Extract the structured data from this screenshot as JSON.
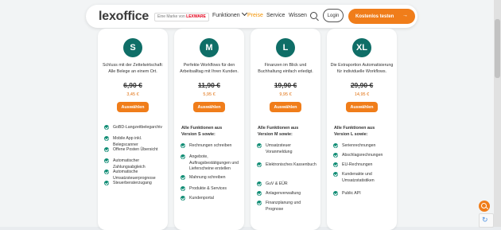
{
  "header": {
    "logo_main": "lexoffice",
    "badge_prefix": "Eine Marke von",
    "badge_brand": "LEXWARE",
    "nav": [
      "Funktionen",
      "Preise",
      "Service",
      "Wissen"
    ],
    "login_label": "Login",
    "cta_label": "Kostenlos testen",
    "cta_arrow": "→"
  },
  "colors": {
    "accent": "#f07d1a",
    "tier": "#0f6e67",
    "check": "#0f8c74"
  },
  "plans": [
    {
      "tier": "S",
      "description": "Schluss mit der Zettelwirtschaft: Alle Belege an einem Ort.",
      "old_price": "6,90 €",
      "new_price": "3,45 €",
      "button": "Auswählen",
      "features_heading": "",
      "features": [
        "GoBD-Langzeitbelegarchiv",
        "Mobile App inkl. Belegscanner",
        "Offene Posten Übersicht",
        "Automatischer Zahlungsabgleich",
        "Automatische Umsatzsteuerprognose",
        "Steuerberaterzugang"
      ]
    },
    {
      "tier": "M",
      "description": "Perfekte Workflows für den Arbeitsalltag mit Ihren Kunden.",
      "old_price": "11,90 €",
      "new_price": "5,95 €",
      "button": "Auswählen",
      "features_heading": "Alle Funktionen aus Version S sowie:",
      "features": [
        "Rechnungen schreiben",
        "Angebote, Auftragsbestätigungen und Lieferscheine erstellen",
        "Mahnung schreiben",
        "Produkte & Services",
        "Kundenportal"
      ]
    },
    {
      "tier": "L",
      "description": "Finanzen im Blick und Buchhaltung einfach erledigt.",
      "old_price": "19,90 €",
      "new_price": "9,95 €",
      "button": "Auswählen",
      "features_heading": "Alle Funktionen aus Version M sowie:",
      "features": [
        "Umsatzsteuer Voranmeldung",
        "Elektronisches Kassenbuch",
        "GuV & EÜR",
        "Anlagenverwaltung",
        "Finanzplanung und Prognose"
      ]
    },
    {
      "tier": "XL",
      "description": "Die Extraportion Automatisierung für individuelle Workflows.",
      "old_price": "29,90 €",
      "new_price": "14,95 €",
      "button": "Auswählen",
      "features_heading": "Alle Funktionen aus Version L sowie:",
      "features": [
        "Serienrechnungen",
        "Abschlagsrechnungen",
        "EU-Rechnungen",
        "Kundenakte und Umsatzstatistiken",
        "Public API"
      ]
    }
  ]
}
